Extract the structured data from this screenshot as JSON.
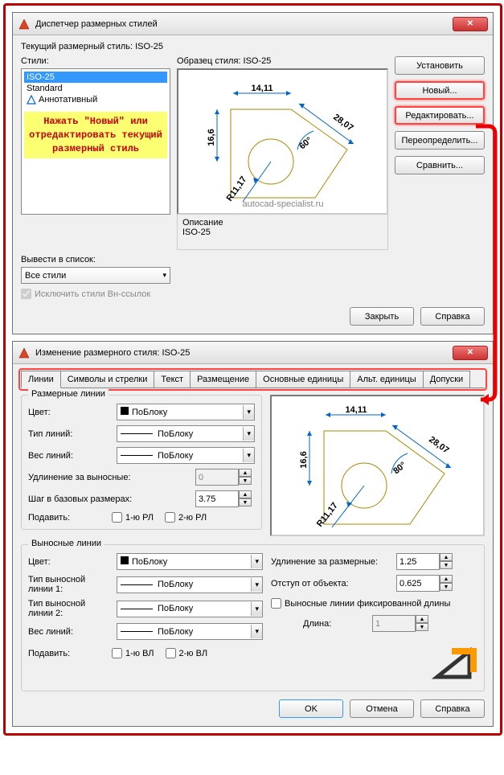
{
  "dialog1": {
    "title": "Диспетчер размерных стилей",
    "current_style_label": "Текущий размерный стиль: ISO-25",
    "styles_label": "Стили:",
    "styles": [
      "ISO-25",
      "Standard",
      "Аннотативный"
    ],
    "hint": "Нажать \"Новый\" или отредактировать текущий размерный стиль",
    "preview_label": "Образец стиля: ISO-25",
    "watermark": "autocad-specialist.ru",
    "desc_label": "Описание",
    "desc_value": "ISO-25",
    "list_label": "Вывести в список:",
    "list_value": "Все стили",
    "exclude_label": "Исключить стили Вн-ссылок",
    "buttons": {
      "set": "Установить",
      "new": "Новый...",
      "modify": "Редактировать...",
      "override": "Переопределить...",
      "compare": "Сравнить..."
    },
    "close": "Закрыть",
    "help": "Справка"
  },
  "dialog2": {
    "title": "Изменение размерного стиля: ISO-25",
    "tabs": [
      "Линии",
      "Символы и стрелки",
      "Текст",
      "Размещение",
      "Основные единицы",
      "Альт. единицы",
      "Допуски"
    ],
    "dimlines": {
      "group": "Размерные линии",
      "color": "Цвет:",
      "color_val": "ПоБлоку",
      "ltype": "Тип линий:",
      "ltype_val": "ПоБлоку",
      "lweight": "Вес линий:",
      "lweight_val": "ПоБлоку",
      "ext": "Удлинение за выносные:",
      "ext_val": "0",
      "baseline": "Шаг в базовых размерах:",
      "baseline_val": "3.75",
      "suppress": "Подавить:",
      "s1": "1-ю РЛ",
      "s2": "2-ю РЛ"
    },
    "extlines": {
      "group": "Выносные линии",
      "color": "Цвет:",
      "color_val": "ПоБлоку",
      "lt1": "Тип выносной линии 1:",
      "lt1_val": "ПоБлоку",
      "lt2": "Тип выносной линии 2:",
      "lt2_val": "ПоБлоку",
      "lweight": "Вес линий:",
      "lweight_val": "ПоБлоку",
      "suppress": "Подавить:",
      "s1": "1-ю ВЛ",
      "s2": "2-ю ВЛ",
      "ext_beyond": "Удлинение за размерные:",
      "ext_beyond_val": "1.25",
      "offset": "Отступ от объекта:",
      "offset_val": "0.625",
      "fixed": "Выносные линии фиксированной длины",
      "length": "Длина:",
      "length_val": "1"
    },
    "ok": "OK",
    "cancel": "Отмена",
    "help": "Справка"
  },
  "preview": {
    "top_dim": "14,11",
    "left_dim": "16,6",
    "radius": "R11,17",
    "angle": "60°",
    "angle2": "80°",
    "right_dim": "28,07"
  }
}
